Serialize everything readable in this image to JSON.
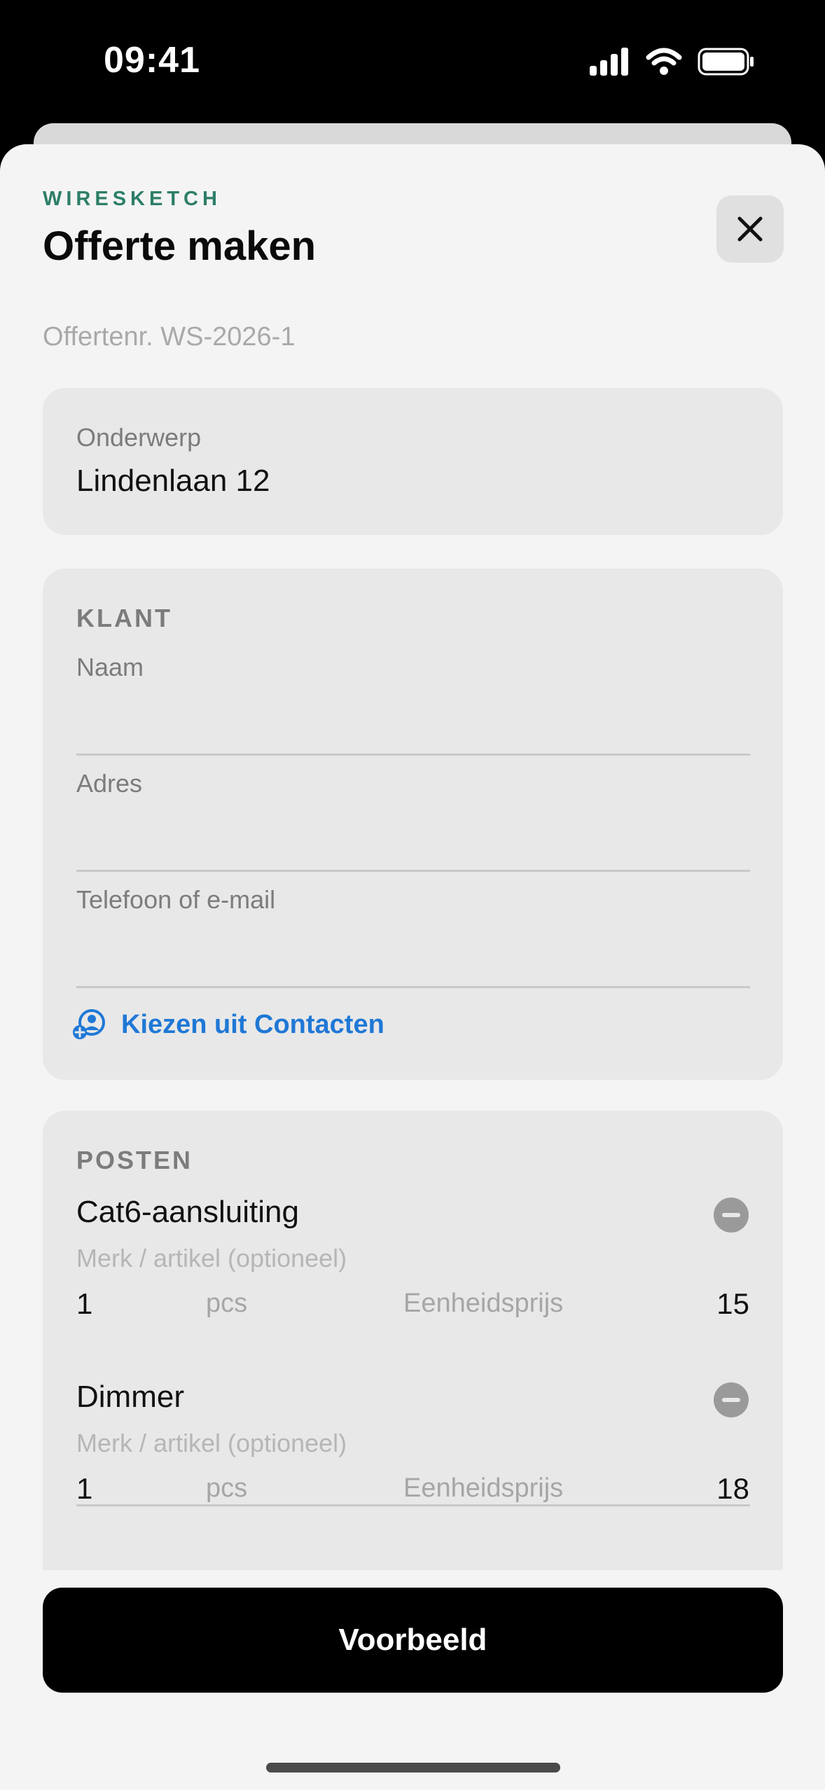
{
  "status_bar": {
    "time": "09:41"
  },
  "header": {
    "brand": "WIRESKETCH",
    "title": "Offerte maken",
    "quote_number": "Offertenr. WS-2026-1"
  },
  "subject": {
    "label": "Onderwerp",
    "value": "Lindenlaan 12"
  },
  "client": {
    "heading": "KLANT",
    "fields": [
      {
        "label": "Naam",
        "value": ""
      },
      {
        "label": "Adres",
        "value": ""
      },
      {
        "label": "Telefoon of e-mail",
        "value": ""
      }
    ],
    "contacts_link": "Kiezen uit Contacten"
  },
  "items": {
    "heading": "POSTEN",
    "lines": [
      {
        "name": "Cat6-aansluiting",
        "brand_placeholder": "Merk / artikel (optioneel)",
        "qty": "1",
        "unit": "pcs",
        "price_label": "Eenheidsprijs",
        "price": "15"
      },
      {
        "name": "Dimmer",
        "brand_placeholder": "Merk / artikel (optioneel)",
        "qty": "1",
        "unit": "pcs",
        "price_label": "Eenheidsprijs",
        "price": "18"
      }
    ]
  },
  "actions": {
    "preview": "Voorbeeld"
  },
  "colors": {
    "accent_green": "#2d7e68",
    "link_blue": "#1f78d6",
    "card_bg": "#e8e8e8"
  }
}
